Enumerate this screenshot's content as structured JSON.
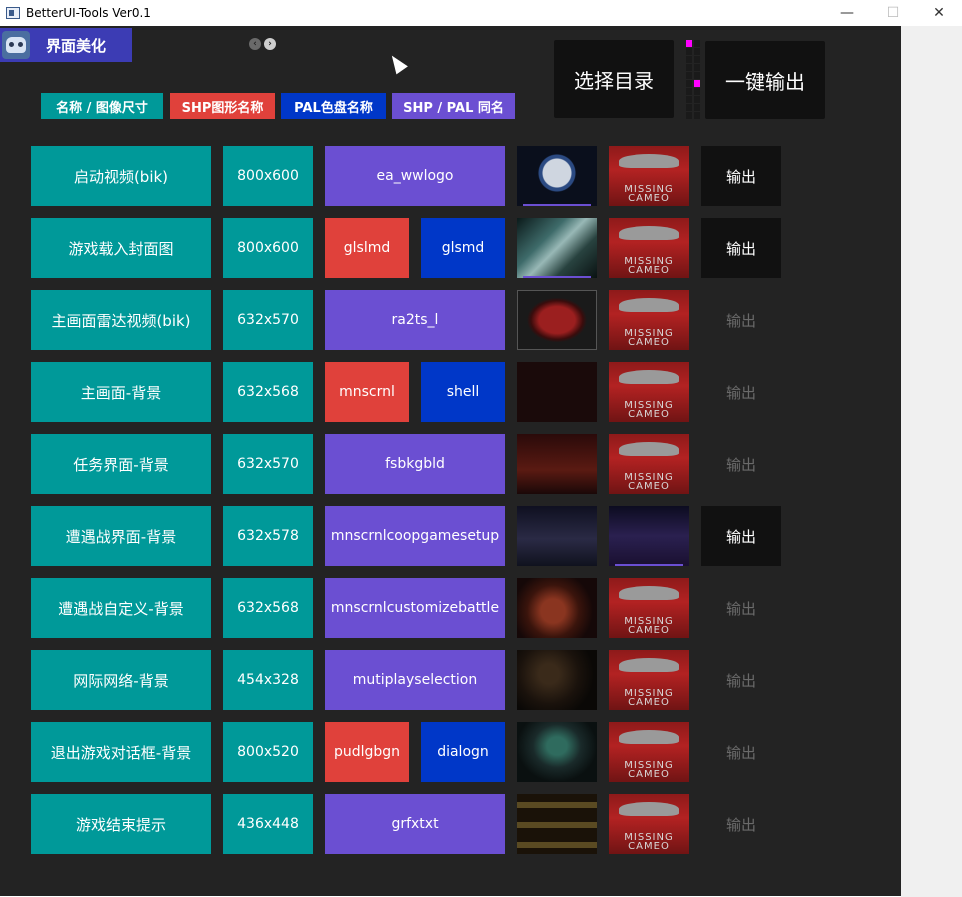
{
  "window": {
    "title": "BetterUI-Tools Ver0.1",
    "minimize": "—",
    "maximize": "☐",
    "close": "✕"
  },
  "tab": {
    "label": "界面美化"
  },
  "nav": {
    "left_arrow": "‹",
    "right_arrow": "›"
  },
  "actions": {
    "select_dir": "选择目录",
    "export_all": "一键输出"
  },
  "legend": [
    {
      "label": "名称 / 图像尺寸",
      "color": "#009999"
    },
    {
      "label": "SHP图形名称",
      "color": "#e0413b"
    },
    {
      "label": "PAL色盘名称",
      "color": "#0037c8"
    },
    {
      "label": "SHP / PAL 同名",
      "color": "#6b4fd2"
    }
  ],
  "missing_label": "MISSING CAMEO",
  "rows": [
    {
      "name": "启动视频(bik)",
      "size": "800x600",
      "shp": "",
      "pal": "",
      "shared": "ea_wwlogo",
      "output": "输出",
      "output_active": true
    },
    {
      "name": "游戏载入封面图",
      "size": "800x600",
      "shp": "glslmd",
      "pal": "glsmd",
      "shared": "",
      "output": "输出",
      "output_active": true
    },
    {
      "name": "主画面雷达视频(bik)",
      "size": "632x570",
      "shp": "",
      "pal": "",
      "shared": "ra2ts_l",
      "output": "输出",
      "output_active": false
    },
    {
      "name": "主画面-背景",
      "size": "632x568",
      "shp": "mnscrnl",
      "pal": "shell",
      "shared": "",
      "output": "输出",
      "output_active": false
    },
    {
      "name": "任务界面-背景",
      "size": "632x570",
      "shp": "",
      "pal": "",
      "shared": "fsbkgbld",
      "output": "输出",
      "output_active": false
    },
    {
      "name": "遭遇战界面-背景",
      "size": "632x578",
      "shp": "",
      "pal": "",
      "shared": "mnscrnlcoopgamesetup",
      "output": "输出",
      "output_active": true
    },
    {
      "name": "遭遇战自定义-背景",
      "size": "632x568",
      "shp": "",
      "pal": "",
      "shared": "mnscrnlcustomizebattle",
      "output": "输出",
      "output_active": false
    },
    {
      "name": "网际网络-背景",
      "size": "454x328",
      "shp": "",
      "pal": "",
      "shared": "mutiplayselection",
      "output": "输出",
      "output_active": false
    },
    {
      "name": "退出游戏对话框-背景",
      "size": "800x520",
      "shp": "pudlgbgn",
      "pal": "dialogn",
      "shared": "",
      "output": "输出",
      "output_active": false
    },
    {
      "name": "游戏结束提示",
      "size": "436x448",
      "shp": "",
      "pal": "",
      "shared": "grfxtxt",
      "output": "输出",
      "output_active": false
    }
  ]
}
